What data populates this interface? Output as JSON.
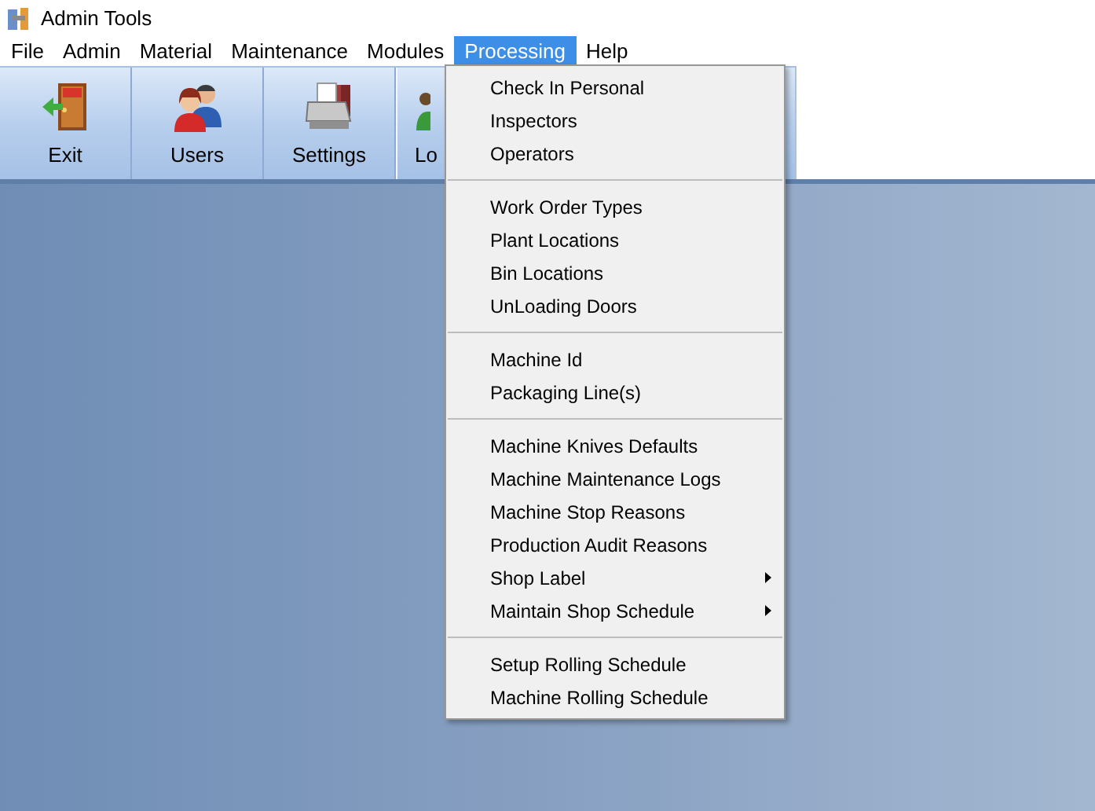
{
  "window": {
    "title": "Admin Tools"
  },
  "menu_bar": [
    {
      "label": "File",
      "selected": false
    },
    {
      "label": "Admin",
      "selected": false
    },
    {
      "label": "Material",
      "selected": false
    },
    {
      "label": "Maintenance",
      "selected": false
    },
    {
      "label": "Modules",
      "selected": false
    },
    {
      "label": "Processing",
      "selected": true
    },
    {
      "label": "Help",
      "selected": false
    }
  ],
  "toolbar": [
    {
      "label": "Exit",
      "kind": "exit"
    },
    {
      "label": "Users",
      "kind": "users"
    },
    {
      "label": "Settings",
      "kind": "settings"
    },
    {
      "label": "Lo",
      "kind": "log"
    }
  ],
  "menu": {
    "groups": [
      [
        {
          "label": "Check In Personal",
          "submenu": false
        },
        {
          "label": "Inspectors",
          "submenu": false
        },
        {
          "label": "Operators",
          "submenu": false
        }
      ],
      [
        {
          "label": "Work Order Types",
          "submenu": false
        },
        {
          "label": "Plant Locations",
          "submenu": false
        },
        {
          "label": "Bin Locations",
          "submenu": false
        },
        {
          "label": "UnLoading Doors",
          "submenu": false
        }
      ],
      [
        {
          "label": "Machine Id",
          "submenu": false
        },
        {
          "label": "Packaging Line(s)",
          "submenu": false
        }
      ],
      [
        {
          "label": "Machine Knives Defaults",
          "submenu": false
        },
        {
          "label": "Machine Maintenance Logs",
          "submenu": false
        },
        {
          "label": "Machine Stop Reasons",
          "submenu": false
        },
        {
          "label": "Production Audit Reasons",
          "submenu": false
        },
        {
          "label": "Shop Label",
          "submenu": true
        },
        {
          "label": "Maintain Shop Schedule",
          "submenu": true
        }
      ],
      [
        {
          "label": "Setup Rolling Schedule",
          "submenu": false
        },
        {
          "label": "Machine Rolling Schedule",
          "submenu": false
        }
      ]
    ]
  }
}
